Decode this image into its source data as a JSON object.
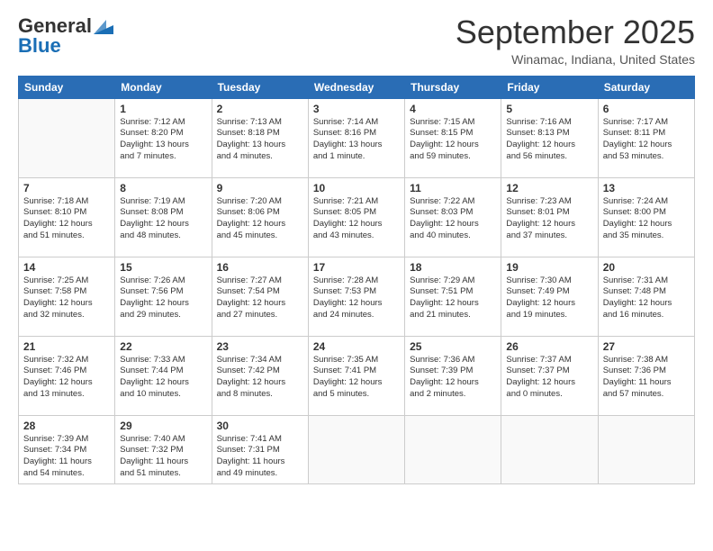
{
  "header": {
    "logo_line1": "General",
    "logo_line2": "Blue",
    "month": "September 2025",
    "location": "Winamac, Indiana, United States"
  },
  "days_of_week": [
    "Sunday",
    "Monday",
    "Tuesday",
    "Wednesday",
    "Thursday",
    "Friday",
    "Saturday"
  ],
  "weeks": [
    [
      {
        "day": "",
        "info": ""
      },
      {
        "day": "1",
        "info": "Sunrise: 7:12 AM\nSunset: 8:20 PM\nDaylight: 13 hours\nand 7 minutes."
      },
      {
        "day": "2",
        "info": "Sunrise: 7:13 AM\nSunset: 8:18 PM\nDaylight: 13 hours\nand 4 minutes."
      },
      {
        "day": "3",
        "info": "Sunrise: 7:14 AM\nSunset: 8:16 PM\nDaylight: 13 hours\nand 1 minute."
      },
      {
        "day": "4",
        "info": "Sunrise: 7:15 AM\nSunset: 8:15 PM\nDaylight: 12 hours\nand 59 minutes."
      },
      {
        "day": "5",
        "info": "Sunrise: 7:16 AM\nSunset: 8:13 PM\nDaylight: 12 hours\nand 56 minutes."
      },
      {
        "day": "6",
        "info": "Sunrise: 7:17 AM\nSunset: 8:11 PM\nDaylight: 12 hours\nand 53 minutes."
      }
    ],
    [
      {
        "day": "7",
        "info": "Sunrise: 7:18 AM\nSunset: 8:10 PM\nDaylight: 12 hours\nand 51 minutes."
      },
      {
        "day": "8",
        "info": "Sunrise: 7:19 AM\nSunset: 8:08 PM\nDaylight: 12 hours\nand 48 minutes."
      },
      {
        "day": "9",
        "info": "Sunrise: 7:20 AM\nSunset: 8:06 PM\nDaylight: 12 hours\nand 45 minutes."
      },
      {
        "day": "10",
        "info": "Sunrise: 7:21 AM\nSunset: 8:05 PM\nDaylight: 12 hours\nand 43 minutes."
      },
      {
        "day": "11",
        "info": "Sunrise: 7:22 AM\nSunset: 8:03 PM\nDaylight: 12 hours\nand 40 minutes."
      },
      {
        "day": "12",
        "info": "Sunrise: 7:23 AM\nSunset: 8:01 PM\nDaylight: 12 hours\nand 37 minutes."
      },
      {
        "day": "13",
        "info": "Sunrise: 7:24 AM\nSunset: 8:00 PM\nDaylight: 12 hours\nand 35 minutes."
      }
    ],
    [
      {
        "day": "14",
        "info": "Sunrise: 7:25 AM\nSunset: 7:58 PM\nDaylight: 12 hours\nand 32 minutes."
      },
      {
        "day": "15",
        "info": "Sunrise: 7:26 AM\nSunset: 7:56 PM\nDaylight: 12 hours\nand 29 minutes."
      },
      {
        "day": "16",
        "info": "Sunrise: 7:27 AM\nSunset: 7:54 PM\nDaylight: 12 hours\nand 27 minutes."
      },
      {
        "day": "17",
        "info": "Sunrise: 7:28 AM\nSunset: 7:53 PM\nDaylight: 12 hours\nand 24 minutes."
      },
      {
        "day": "18",
        "info": "Sunrise: 7:29 AM\nSunset: 7:51 PM\nDaylight: 12 hours\nand 21 minutes."
      },
      {
        "day": "19",
        "info": "Sunrise: 7:30 AM\nSunset: 7:49 PM\nDaylight: 12 hours\nand 19 minutes."
      },
      {
        "day": "20",
        "info": "Sunrise: 7:31 AM\nSunset: 7:48 PM\nDaylight: 12 hours\nand 16 minutes."
      }
    ],
    [
      {
        "day": "21",
        "info": "Sunrise: 7:32 AM\nSunset: 7:46 PM\nDaylight: 12 hours\nand 13 minutes."
      },
      {
        "day": "22",
        "info": "Sunrise: 7:33 AM\nSunset: 7:44 PM\nDaylight: 12 hours\nand 10 minutes."
      },
      {
        "day": "23",
        "info": "Sunrise: 7:34 AM\nSunset: 7:42 PM\nDaylight: 12 hours\nand 8 minutes."
      },
      {
        "day": "24",
        "info": "Sunrise: 7:35 AM\nSunset: 7:41 PM\nDaylight: 12 hours\nand 5 minutes."
      },
      {
        "day": "25",
        "info": "Sunrise: 7:36 AM\nSunset: 7:39 PM\nDaylight: 12 hours\nand 2 minutes."
      },
      {
        "day": "26",
        "info": "Sunrise: 7:37 AM\nSunset: 7:37 PM\nDaylight: 12 hours\nand 0 minutes."
      },
      {
        "day": "27",
        "info": "Sunrise: 7:38 AM\nSunset: 7:36 PM\nDaylight: 11 hours\nand 57 minutes."
      }
    ],
    [
      {
        "day": "28",
        "info": "Sunrise: 7:39 AM\nSunset: 7:34 PM\nDaylight: 11 hours\nand 54 minutes."
      },
      {
        "day": "29",
        "info": "Sunrise: 7:40 AM\nSunset: 7:32 PM\nDaylight: 11 hours\nand 51 minutes."
      },
      {
        "day": "30",
        "info": "Sunrise: 7:41 AM\nSunset: 7:31 PM\nDaylight: 11 hours\nand 49 minutes."
      },
      {
        "day": "",
        "info": ""
      },
      {
        "day": "",
        "info": ""
      },
      {
        "day": "",
        "info": ""
      },
      {
        "day": "",
        "info": ""
      }
    ]
  ]
}
